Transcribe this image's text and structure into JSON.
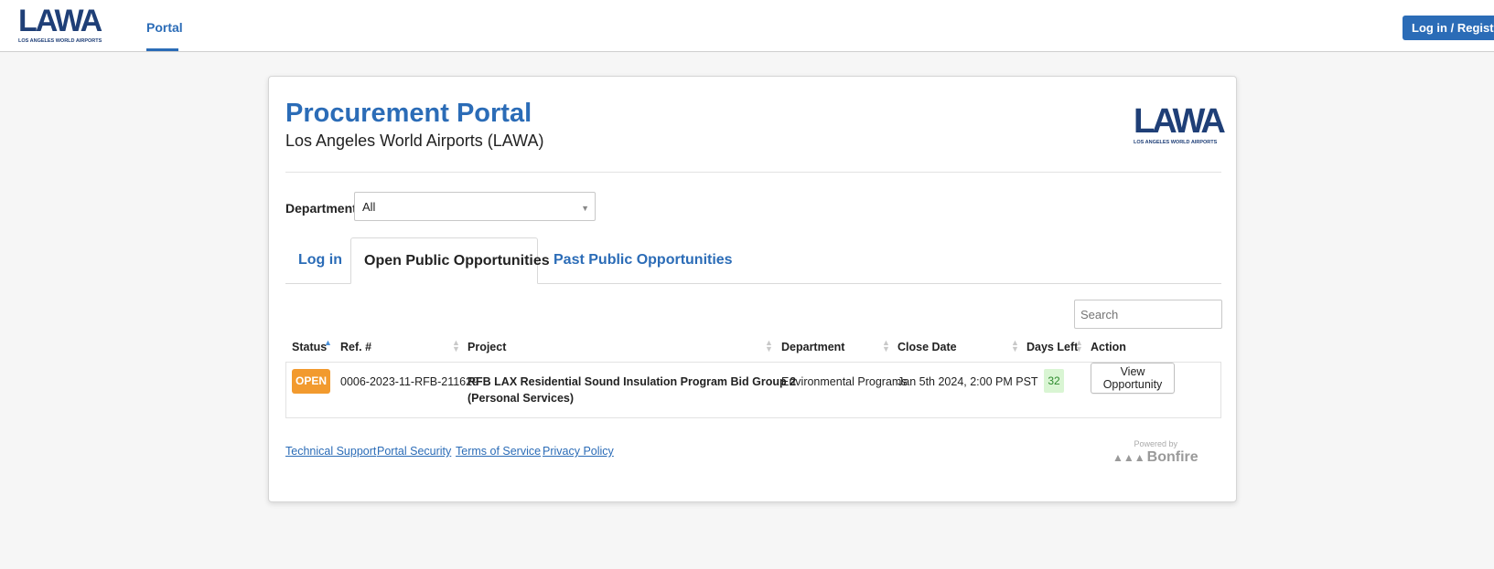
{
  "header": {
    "logo_text": "LAWA",
    "logo_subtext": "LOS ANGELES WORLD AIRPORTS",
    "nav_portal": "Portal",
    "login_register": "Log in / Register"
  },
  "card": {
    "title": "Procurement Portal",
    "subtitle": "Los Angeles World Airports (LAWA)",
    "logo_text": "LAWA",
    "logo_subtext": "LOS ANGELES WORLD AIRPORTS",
    "department_label": "Department:",
    "department_value": "All"
  },
  "tabs": [
    {
      "label": "Log in",
      "active": false
    },
    {
      "label": "Open Public Opportunities",
      "active": true
    },
    {
      "label": "Past Public Opportunities",
      "active": false
    }
  ],
  "search": {
    "placeholder": "Search"
  },
  "table": {
    "headers": [
      "Status",
      "Ref. #",
      "Project",
      "Department",
      "Close Date",
      "Days Left",
      "Action"
    ],
    "rows": [
      {
        "status": "OPEN",
        "ref": "0006-2023-11-RFB-211629",
        "project_line1": "RFB LAX Residential Sound Insulation Program Bid Group 2",
        "project_line2": "(Personal Services)",
        "department": "Environmental Programs",
        "close_date": "Jan 5th 2024, 2:00 PM PST",
        "days_left": "32",
        "action": "View Opportunity"
      }
    ]
  },
  "footer": {
    "links": [
      "Technical Support",
      "Portal Security",
      "Terms of Service",
      "Privacy Policy"
    ],
    "powered_by": "Powered by",
    "bonfire": "Bonfire"
  },
  "colors": {
    "brand_blue": "#2b6cb7",
    "logo_navy": "#1f3f77",
    "status_open": "#f29a2e",
    "days_left_bg": "#d9f5d3"
  },
  "icons": {
    "sort": "sort-icon",
    "sort_asc": "sort-asc-icon",
    "dropdown": "chevron-down-icon",
    "bonfire_logo": "bonfire-logo-icon"
  }
}
